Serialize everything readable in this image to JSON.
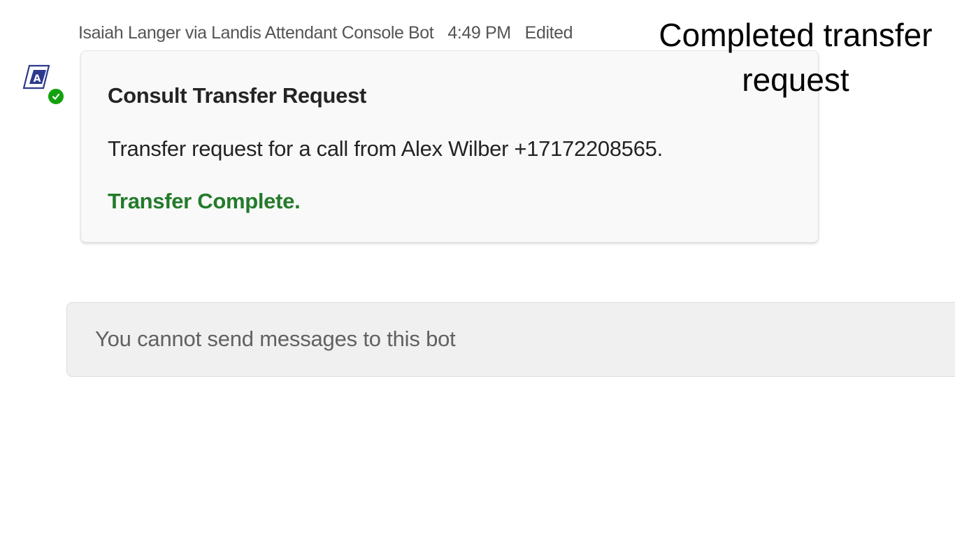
{
  "message": {
    "sender": "Isaiah Langer via Landis Attendant Console Bot",
    "time": "4:49 PM",
    "edited_label": "Edited",
    "presence": "available",
    "presence_color": "#13a10e"
  },
  "card": {
    "title": "Consult Transfer Request",
    "body": "Transfer request for a call from Alex Wilber +17172208565.",
    "status": "Transfer Complete.",
    "status_color": "#237b2b"
  },
  "compose": {
    "disabled_text": "You cannot send messages to this bot"
  },
  "annotation": {
    "caption": "Completed transfer request"
  },
  "icons": {
    "avatar": "landis-bot-logo-icon",
    "presence": "checkmark-icon"
  }
}
